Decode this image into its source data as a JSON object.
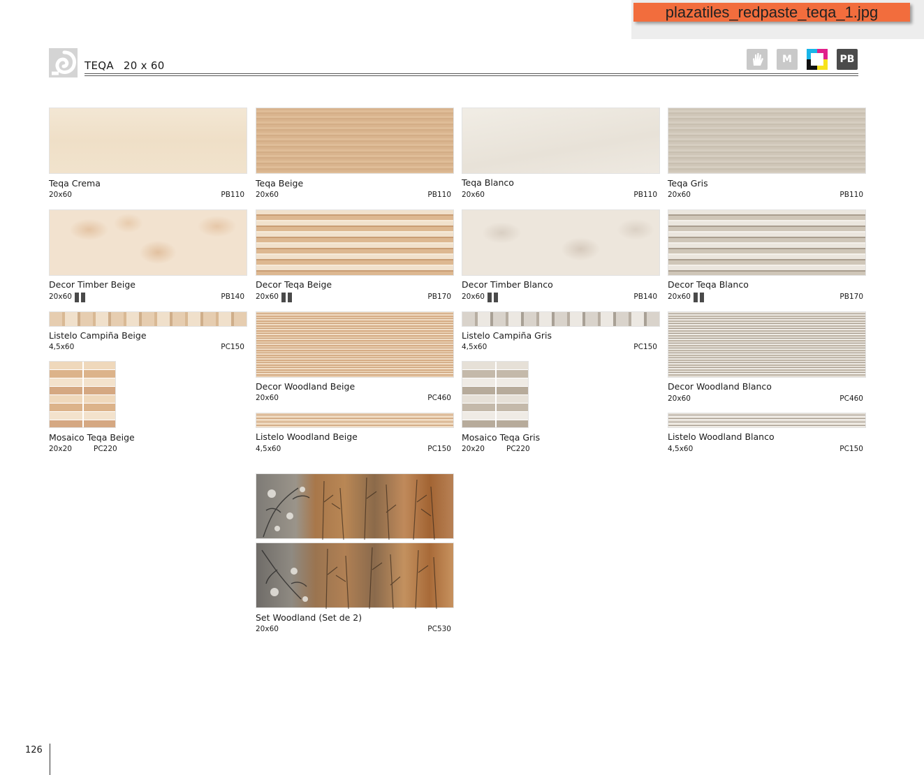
{
  "file_label": "plazatiles_redpaste_teqa_1.jpg",
  "header": {
    "title": "TEQA",
    "size": "20 x 60",
    "icons": [
      "hand-icon",
      "m-icon",
      "cmyk-icon",
      "pb-icon"
    ],
    "m_label": "M",
    "pb_label": "PB"
  },
  "page_number": "126",
  "colors": {
    "banner": "#f26d3d",
    "dark_badge": "#4b4b4b",
    "light_badge": "#c9c9c9"
  },
  "tiles": {
    "teqa_crema": {
      "name": "Teqa Crema",
      "size": "20x60",
      "code": "PB110"
    },
    "teqa_beige": {
      "name": "Teqa Beige",
      "size": "20x60",
      "code": "PB110"
    },
    "teqa_blanco": {
      "name": "Teqa Blanco",
      "size": "20x60",
      "code": "PB110"
    },
    "teqa_gris": {
      "name": "Teqa Gris",
      "size": "20x60",
      "code": "PB110"
    },
    "decor_timber_beige": {
      "name": "Decor Timber Beige",
      "size": "20x60",
      "code": "PB140"
    },
    "decor_teqa_beige": {
      "name": "Decor Teqa Beige",
      "size": "20x60",
      "code": "PB170"
    },
    "decor_timber_blanco": {
      "name": "Decor Timber Blanco",
      "size": "20x60",
      "code": "PB140"
    },
    "decor_teqa_blanco": {
      "name": "Decor Teqa Blanco",
      "size": "20x60",
      "code": "PB170"
    },
    "listelo_campina_beige": {
      "name": "Listelo Campiña Beige",
      "size": "4,5x60",
      "code": "PC150"
    },
    "decor_woodland_beige": {
      "name": "Decor Woodland Beige",
      "size": "20x60",
      "code": "PC460"
    },
    "listelo_campina_gris": {
      "name": "Listelo Campiña Gris",
      "size": "4,5x60",
      "code": "PC150"
    },
    "decor_woodland_blanco": {
      "name": "Decor Woodland Blanco",
      "size": "20x60",
      "code": "PC460"
    },
    "mosaico_teqa_beige": {
      "name": "Mosaico Teqa Beige",
      "size": "20x20",
      "code": "PC220"
    },
    "listelo_woodland_beige": {
      "name": "Listelo Woodland Beige",
      "size": "4,5x60",
      "code": "PC150"
    },
    "mosaico_teqa_gris": {
      "name": "Mosaico Teqa Gris",
      "size": "20x20",
      "code": "PC220"
    },
    "listelo_woodland_blanco": {
      "name": "Listelo Woodland Blanco",
      "size": "4,5x60",
      "code": "PC150"
    },
    "set_woodland": {
      "name": "Set Woodland (Set de 2)",
      "size": "20x60",
      "code": "PC530"
    }
  }
}
